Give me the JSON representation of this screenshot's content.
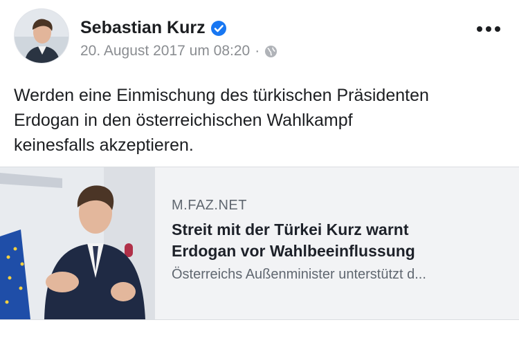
{
  "post": {
    "author": "Sebastian Kurz",
    "verified_icon": "verified-badge-icon",
    "timestamp": "20. August 2017 um 08:20",
    "separator": "·",
    "audience_icon": "globe-icon",
    "more_icon": "more-options-icon",
    "text_lines": [
      "Werden eine Einmischung des türkischen Präsidenten",
      "Erdogan in den österreichischen Wahlkampf",
      "keinesfalls akzeptieren."
    ]
  },
  "link_preview": {
    "domain": "M.FAZ.NET",
    "title_lines": [
      "Streit mit der Türkei Kurz warnt",
      "Erdogan vor Wahlbeeinflussung"
    ],
    "description": "Österreichs Außenminister unterstützt d..."
  },
  "colors": {
    "verified_blue": "#1877f2",
    "meta_gray": "#8a8d91",
    "card_background": "#f2f3f5"
  }
}
